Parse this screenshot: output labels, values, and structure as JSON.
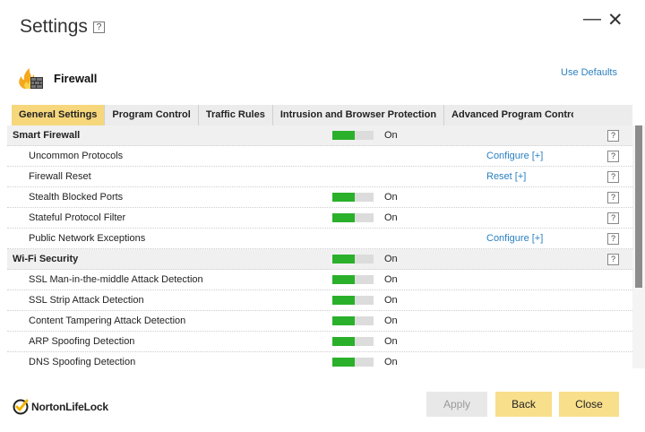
{
  "window": {
    "title": "Settings",
    "help": "?",
    "minimize": "—",
    "close": "✕"
  },
  "header": {
    "section": "Firewall",
    "use_defaults": "Use Defaults"
  },
  "tabs": [
    {
      "label": "General Settings",
      "active": true
    },
    {
      "label": "Program Control",
      "active": false
    },
    {
      "label": "Traffic Rules",
      "active": false
    },
    {
      "label": "Intrusion and Browser Protection",
      "active": false
    },
    {
      "label": "Advanced Program Control",
      "active": false
    }
  ],
  "rows": [
    {
      "kind": "section",
      "label": "Smart Firewall",
      "toggle_level": 0.55,
      "state": "On",
      "help": "?"
    },
    {
      "kind": "item",
      "label": "Uncommon Protocols",
      "action": "Configure [+]",
      "help": "?"
    },
    {
      "kind": "item",
      "label": "Firewall Reset",
      "action": "Reset [+]",
      "help": "?"
    },
    {
      "kind": "item",
      "label": "Stealth Blocked Ports",
      "toggle_level": 0.55,
      "state": "On",
      "help": "?"
    },
    {
      "kind": "item",
      "label": "Stateful Protocol Filter",
      "toggle_level": 0.55,
      "state": "On",
      "help": "?"
    },
    {
      "kind": "item",
      "label": "Public Network Exceptions",
      "action": "Configure [+]",
      "help": "?"
    },
    {
      "kind": "section",
      "label": "Wi-Fi Security",
      "toggle_level": 0.55,
      "state": "On",
      "help": "?"
    },
    {
      "kind": "item",
      "label": "SSL Man-in-the-middle Attack Detection",
      "toggle_level": 0.55,
      "state": "On"
    },
    {
      "kind": "item",
      "label": "SSL Strip Attack Detection",
      "toggle_level": 0.55,
      "state": "On"
    },
    {
      "kind": "item",
      "label": "Content Tampering Attack Detection",
      "toggle_level": 0.55,
      "state": "On"
    },
    {
      "kind": "item",
      "label": "ARP Spoofing Detection",
      "toggle_level": 0.55,
      "state": "On"
    },
    {
      "kind": "item",
      "label": "DNS Spoofing Detection",
      "toggle_level": 0.55,
      "state": "On"
    }
  ],
  "footer": {
    "logo_text": "NortonLifeLock",
    "apply": "Apply",
    "back": "Back",
    "close": "Close"
  },
  "colors": {
    "accent": "#f6d77c",
    "toggle_on": "#2ab02a",
    "link": "#2a80c2",
    "button": "#f8df8c"
  }
}
